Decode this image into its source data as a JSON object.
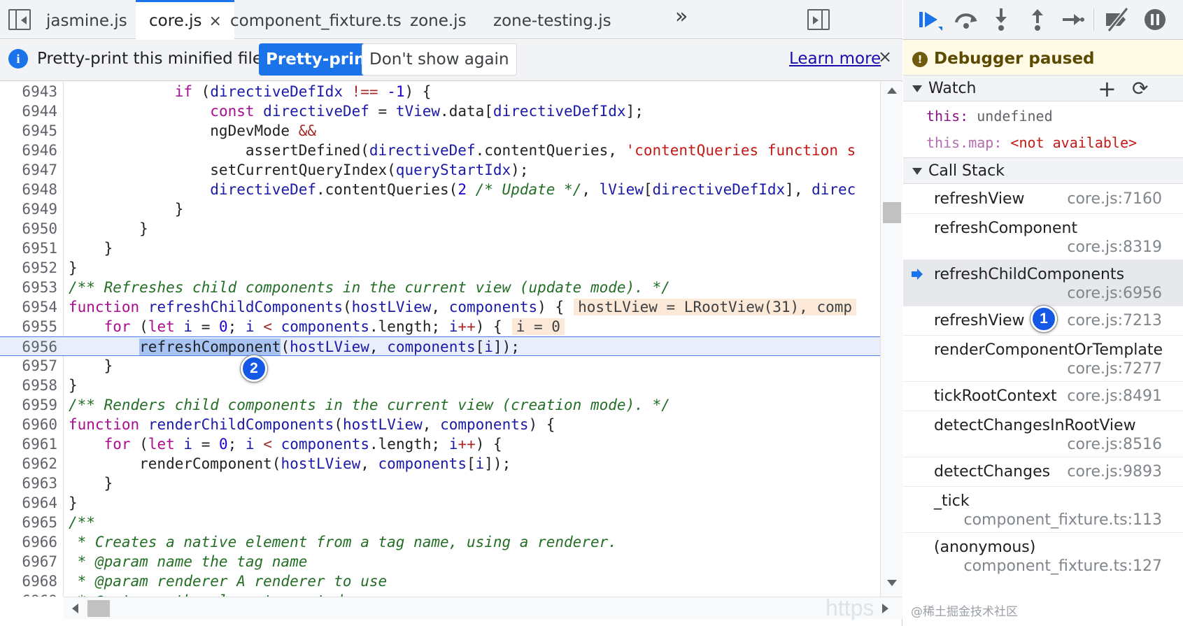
{
  "tabs": [
    {
      "label": "jasmine.js",
      "active": false
    },
    {
      "label": "core.js",
      "active": true,
      "close": "×"
    },
    {
      "label": "component_fixture.ts",
      "active": false
    },
    {
      "label": "zone.js",
      "active": false
    },
    {
      "label": "zone-testing.js",
      "active": false
    }
  ],
  "more_tabs": "»",
  "infobar": {
    "message": "Pretty-print this minified file?",
    "pretty_print": "Pretty-print",
    "dont_show": "Don't show again",
    "learn_more": "Learn more",
    "close": "×"
  },
  "code": {
    "current_line": "6956",
    "lines": [
      {
        "n": "6943",
        "html": "            <span class='tok-kw'>if</span> (<span class='tok-var'>directiveDefIdx</span> <span class='tok-op'>!==</span> <span class='tok-num'>-1</span>) {"
      },
      {
        "n": "6944",
        "html": "                <span class='tok-kw'>const</span> <span class='tok-var'>directiveDef</span> = <span class='tok-var'>tView</span>.data[<span class='tok-var'>directiveDefIdx</span>];"
      },
      {
        "n": "6945",
        "html": "                ngDevMode <span class='tok-op'>&amp;&amp;</span>"
      },
      {
        "n": "6946",
        "html": "                    assertDefined(<span class='tok-var'>directiveDef</span>.contentQueries, <span class='tok-str'>'contentQueries function s</span>"
      },
      {
        "n": "6947",
        "html": "                setCurrentQueryIndex(<span class='tok-var'>queryStartIdx</span>);"
      },
      {
        "n": "6948",
        "html": "                <span class='tok-var'>directiveDef</span>.contentQueries(<span class='tok-num'>2</span> <span class='tok-cm'>/* Update */</span>, <span class='tok-var'>lView</span>[<span class='tok-var'>directiveDefIdx</span>], <span class='tok-var'>direc</span>"
      },
      {
        "n": "6949",
        "html": "            }"
      },
      {
        "n": "6950",
        "html": "        }"
      },
      {
        "n": "6951",
        "html": "    }"
      },
      {
        "n": "6952",
        "html": "}"
      },
      {
        "n": "6953",
        "html": "<span class='tok-cm'>/** Refreshes child components in the current view (update mode). */</span>"
      },
      {
        "n": "6954",
        "html": "<span class='tok-kw'>function</span> <span class='tok-var'>refreshChildComponents</span>(<span class='tok-var'>hostLView</span>, <span class='tok-var'>components</span>) {<span class='inline-val'>hostLView = LRootView(31), comp</span>"
      },
      {
        "n": "6955",
        "html": "    <span class='tok-kw'>for</span> (<span class='tok-kw'>let</span> <span class='tok-var'>i</span> = <span class='tok-num'>0</span>; <span class='tok-var'>i</span> <span class='tok-op'>&lt;</span> <span class='tok-var'>components</span>.length; <span class='tok-var'>i</span><span class='tok-op'>++</span>) {<span class='inline-val'>i = 0</span>"
      },
      {
        "n": "6956",
        "html": "        <span class='hl-call'>refreshComponent</span>(<span class='tok-var'>hostLView</span>, <span class='tok-var'>components</span>[<span class='tok-var'>i</span>]);"
      },
      {
        "n": "6957",
        "html": "    }"
      },
      {
        "n": "6958",
        "html": "}"
      },
      {
        "n": "6959",
        "html": "<span class='tok-cm'>/** Renders child components in the current view (creation mode). */</span>"
      },
      {
        "n": "6960",
        "html": "<span class='tok-kw'>function</span> <span class='tok-var'>renderChildComponents</span>(<span class='tok-var'>hostLView</span>, <span class='tok-var'>components</span>) {"
      },
      {
        "n": "6961",
        "html": "    <span class='tok-kw'>for</span> (<span class='tok-kw'>let</span> <span class='tok-var'>i</span> = <span class='tok-num'>0</span>; <span class='tok-var'>i</span> <span class='tok-op'>&lt;</span> <span class='tok-var'>components</span>.length; <span class='tok-var'>i</span><span class='tok-op'>++</span>) {"
      },
      {
        "n": "6962",
        "html": "        renderComponent(<span class='tok-var'>hostLView</span>, <span class='tok-var'>components</span>[<span class='tok-var'>i</span>]);"
      },
      {
        "n": "6963",
        "html": "    }"
      },
      {
        "n": "6964",
        "html": "}"
      },
      {
        "n": "6965",
        "html": "<span class='tok-cm'>/**</span>"
      },
      {
        "n": "6966",
        "html": "<span class='tok-cm'> * Creates a native element from a tag name, using a renderer.</span>"
      },
      {
        "n": "6967",
        "html": "<span class='tok-cm'> * @param name the tag name</span>"
      },
      {
        "n": "6968",
        "html": "<span class='tok-cm'> * @param renderer A renderer to use</span>"
      },
      {
        "n": "6969",
        "html": "<span class='tok-cm'> * @returns the element created</span>"
      }
    ]
  },
  "debugger": {
    "paused_text": "Debugger paused",
    "paused_icon": "!",
    "watch": {
      "title": "Watch",
      "add": "+",
      "refresh": "⟳",
      "items": [
        {
          "name": "this",
          "sep": ": ",
          "value": "undefined",
          "na": false
        },
        {
          "name": "this.map",
          "sep": ": ",
          "value": "<not available>",
          "na": true
        }
      ]
    },
    "call_stack": {
      "title": "Call Stack",
      "frames": [
        {
          "name": "refreshView",
          "location": "core.js:7160"
        },
        {
          "name": "refreshComponent",
          "location": "core.js:8319"
        },
        {
          "name": "refreshChildComponents",
          "location": "core.js:6956",
          "selected": true
        },
        {
          "name": "refreshView",
          "location": "core.js:7213"
        },
        {
          "name": "renderComponentOrTemplate",
          "location": "core.js:7277"
        },
        {
          "name": "tickRootContext",
          "location": "core.js:8491"
        },
        {
          "name": "detectChangesInRootView",
          "location": "core.js:8516"
        },
        {
          "name": "detectChanges",
          "location": "core.js:9893"
        },
        {
          "name": "_tick",
          "location": "component_fixture.ts:113"
        },
        {
          "name": "(anonymous)",
          "location": "component_fixture.ts:127"
        }
      ]
    }
  },
  "badges": {
    "one": "1",
    "two": "2"
  },
  "watermark": {
    "left": "https",
    "right": "@稀土掘金技术社区"
  },
  "colors": {
    "accent": "#1a73e8",
    "current_line": "#e8eefb",
    "badge": "#1658e6",
    "paused_banner": "#fffbe6"
  }
}
